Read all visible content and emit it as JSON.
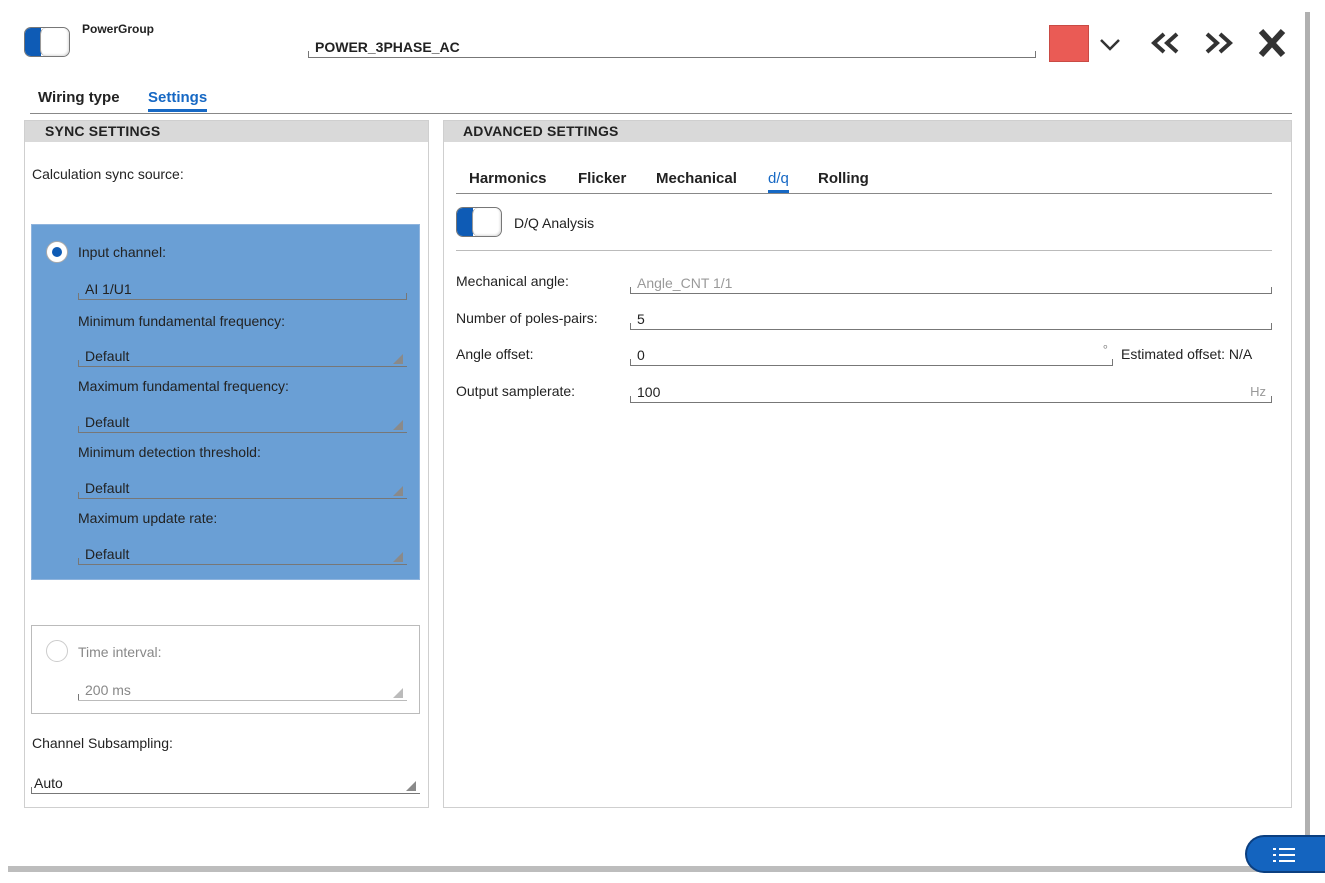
{
  "header": {
    "group_label": "PowerGroup",
    "group_name": "POWER_3PHASE_AC",
    "color_swatch": "#ea5b55"
  },
  "main_tabs": {
    "wiring": "Wiring type",
    "settings": "Settings"
  },
  "sync": {
    "title": "SYNC SETTINGS",
    "source_label": "Calculation sync source:",
    "input_channel_label": "Input channel:",
    "input_channel_value": "AI 1/U1",
    "min_freq_label": "Minimum fundamental frequency:",
    "min_freq_value": "Default",
    "max_freq_label": "Maximum fundamental frequency:",
    "max_freq_value": "Default",
    "min_thresh_label": "Minimum detection threshold:",
    "min_thresh_value": "Default",
    "max_rate_label": "Maximum update rate:",
    "max_rate_value": "Default",
    "time_interval_label": "Time interval:",
    "time_interval_value": "200 ms",
    "subsampling_label": "Channel Subsampling:",
    "subsampling_value": "Auto"
  },
  "advanced": {
    "title": "ADVANCED SETTINGS",
    "tabs": [
      "Harmonics",
      "Flicker",
      "Mechanical",
      "d/q",
      "Rolling"
    ],
    "active_tab": "d/q",
    "dq_toggle_label": "D/Q Analysis",
    "mech_angle_label": "Mechanical angle:",
    "mech_angle_value": "Angle_CNT 1/1",
    "poles_label": "Number of poles-pairs:",
    "poles_value": "5",
    "angle_offset_label": "Angle offset:",
    "angle_offset_value": "0",
    "angle_offset_unit": "°",
    "estimated_offset": "Estimated offset: N/A",
    "samplerate_label": "Output samplerate:",
    "samplerate_value": "100",
    "samplerate_unit": "Hz"
  },
  "colors": {
    "accent": "#1668c4",
    "selected_panel": "#6a9fd5",
    "swatch": "#ea5b55"
  }
}
